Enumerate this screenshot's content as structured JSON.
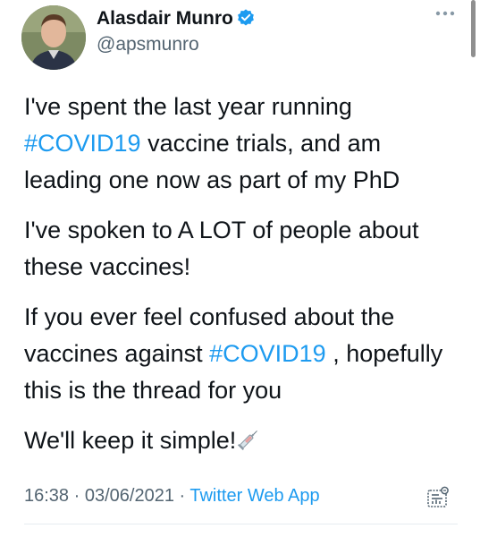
{
  "author": {
    "display_name": "Alasdair Munro",
    "handle": "@apsmunro",
    "verified": true,
    "verified_icon": "verified-badge-icon",
    "avatar_icon": "profile-photo"
  },
  "menu": {
    "icon": "more-options-icon"
  },
  "tweet": {
    "p1": {
      "before": "I've spent the last year running ",
      "hashtag": "#COVID19",
      "after": " vaccine trials, and am leading one now as part of my PhD"
    },
    "p2": "I've spoken to A LOT of people about these vaccines!",
    "p3": {
      "before": "If you ever feel confused about the vaccines against ",
      "hashtag": "#COVID19",
      "after": " , hopefully this is the thread for you"
    },
    "p4": {
      "text": "We'll keep it simple!",
      "emoji_icon": "syringe-icon"
    }
  },
  "meta": {
    "time": "16:38",
    "separator": " · ",
    "date": "03/06/2021",
    "source": "Twitter Web App",
    "analytics_icon": "analytics-icon"
  },
  "colors": {
    "link": "#1d9bf0",
    "secondary_text": "#536471",
    "primary_text": "#0f1419"
  }
}
